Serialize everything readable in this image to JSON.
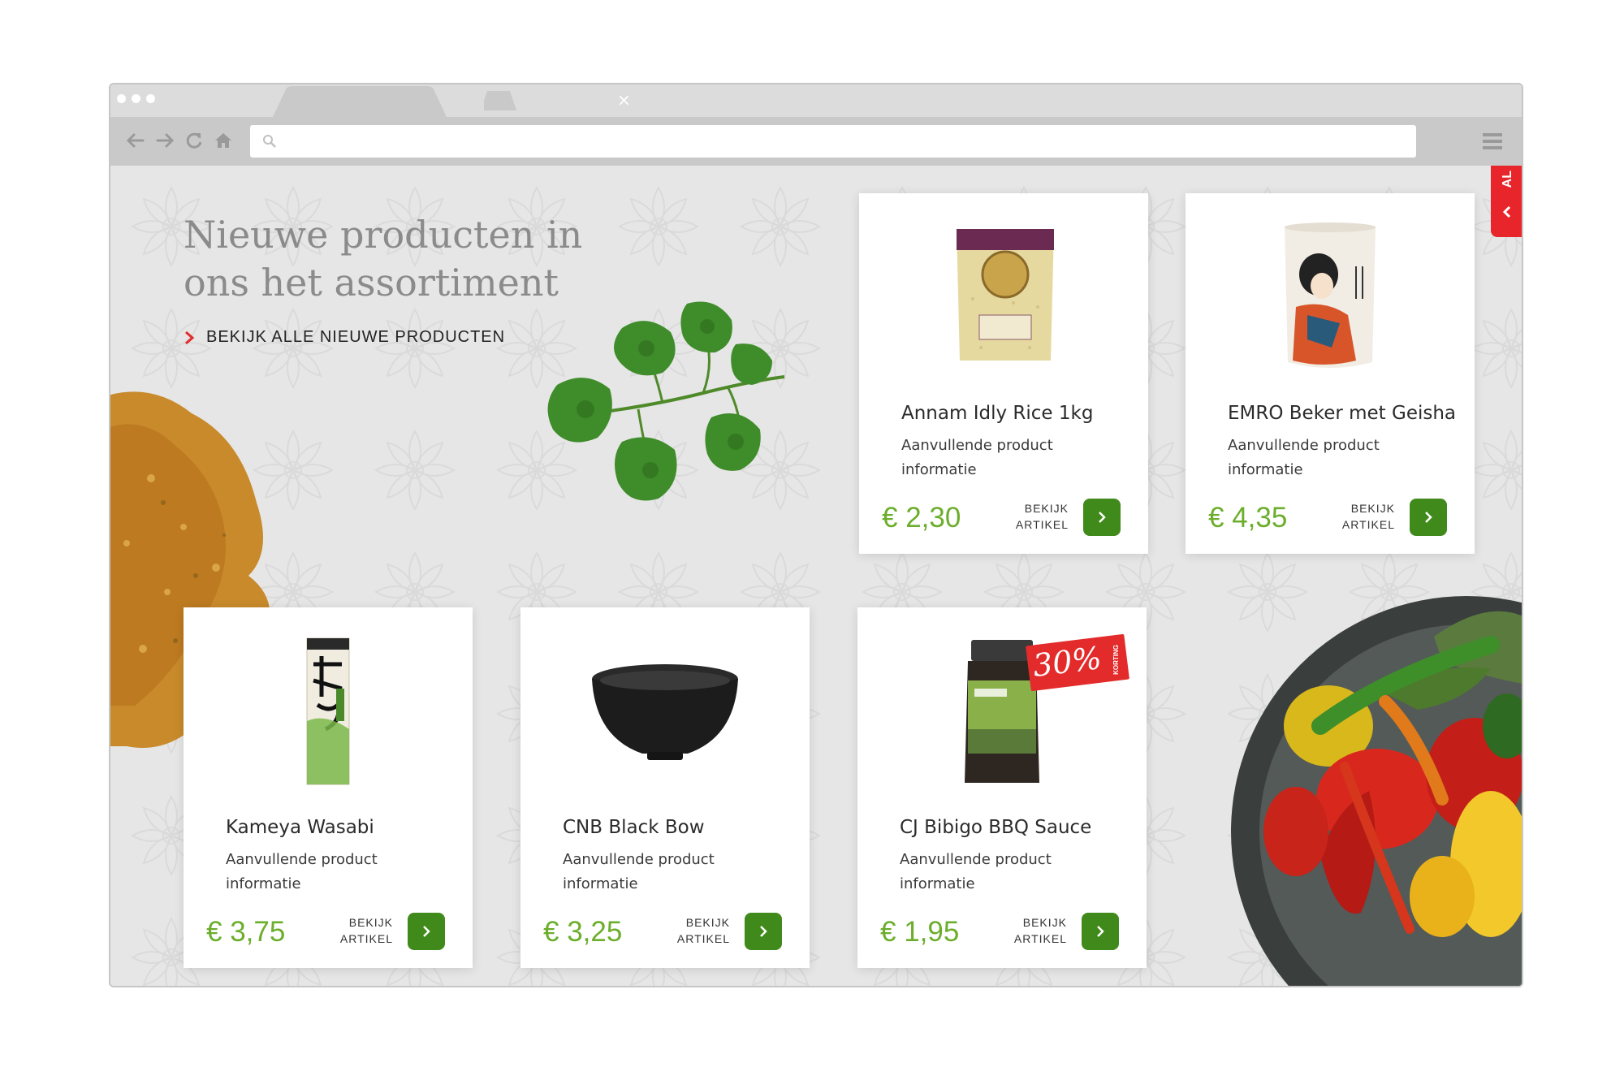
{
  "hero": {
    "title": "Nieuwe producten in ons het assortiment",
    "cta_label": "BEKIJK ALLE NIEUWE PRODUCTEN"
  },
  "sidetab": {
    "label": "AL"
  },
  "view_label_line1": "BEKIJK",
  "view_label_line2": "ARTIKEL",
  "products": [
    {
      "name": "Annam Idly Rice 1kg",
      "description": "Aanvullende product informatie",
      "price": "€ 2,30",
      "image_icon": "rice-bag"
    },
    {
      "name": "EMRO Beker met Geisha",
      "description": "Aanvullende product informatie",
      "price": "€ 4,35",
      "image_icon": "geisha-cup"
    },
    {
      "name": "Kameya Wasabi",
      "description": "Aanvullende product informatie",
      "price": "€ 3,75",
      "image_icon": "wasabi-tube"
    },
    {
      "name": "CNB Black Bow",
      "description": "Aanvullende product informatie",
      "price": "€ 3,25",
      "image_icon": "black-bowl"
    },
    {
      "name": "CJ Bibigo BBQ Sauce",
      "description": "Aanvullende product informatie",
      "price": "€ 1,95",
      "image_icon": "sauce-jar",
      "badge": {
        "value": "30%",
        "label": "KORTING"
      }
    }
  ],
  "colors": {
    "price_green": "#6cae2c",
    "button_green": "#3f8a1a",
    "accent_red": "#e32b2b",
    "page_bg": "#e6e6e6"
  }
}
